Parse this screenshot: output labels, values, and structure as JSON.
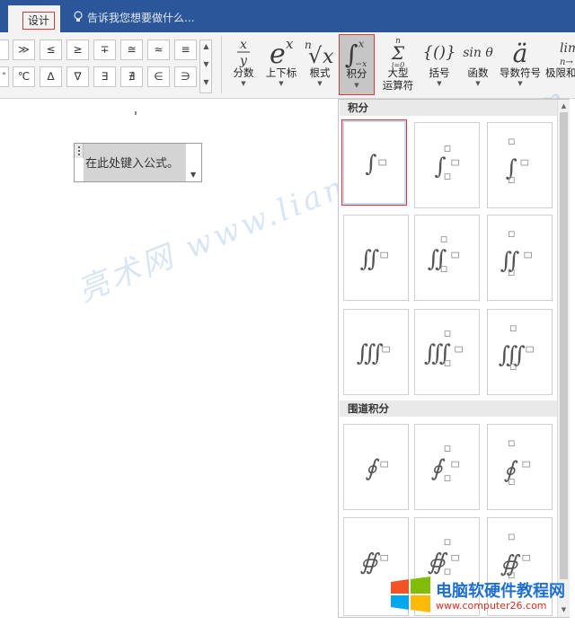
{
  "tabs": {
    "design": "设计"
  },
  "tellme": {
    "placeholder": "告诉我您想要做什么..."
  },
  "symbols": [
    "≫",
    "≤",
    "≥",
    "∓",
    "≅",
    "≈",
    "≡",
    "℃",
    "∆",
    "∇",
    "∃",
    "∄",
    "∈",
    "∋"
  ],
  "ribbon": {
    "fraction": "分数",
    "script": "上下标",
    "radical": "根式",
    "integral": "积分",
    "large_operator": "大型",
    "large_operator_2": "运算符",
    "bracket": "括号",
    "function": "函数",
    "accent": "导数符号",
    "limit_log": "极限和"
  },
  "equation": {
    "placeholder": "在此处键入公式。"
  },
  "panel": {
    "integrals_header": "积分",
    "contour_header": "围道积分"
  },
  "watermark": "亮术网 www.liangshunet.com",
  "logo": {
    "title": "电脑软硬件教程网",
    "url": "www.computer26.com"
  },
  "colors": {
    "title_bar": "#2b579a",
    "highlight": "#d83b3b"
  }
}
